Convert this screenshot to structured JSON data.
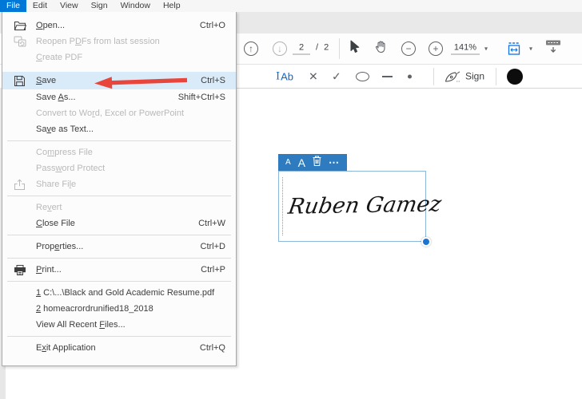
{
  "colors": {
    "accent_blue": "#0078d7",
    "menu_highlight": "#d9eaf8",
    "tool_blue": "#1473e6",
    "signature_toolbar_blue": "#2e7cbf",
    "selection_border_blue": "#8ab7da",
    "resize_handle_blue": "#1b74d2",
    "arrow_red": "#e8463c"
  },
  "menubar": {
    "items": [
      {
        "label": "File",
        "active": true
      },
      {
        "label": "Edit",
        "active": false
      },
      {
        "label": "View",
        "active": false
      },
      {
        "label": "Sign",
        "active": false
      },
      {
        "label": "Window",
        "active": false
      },
      {
        "label": "Help",
        "active": false
      }
    ]
  },
  "file_menu": {
    "items": [
      {
        "type": "item",
        "label": "Open...",
        "mnemonic": 0,
        "shortcut": "Ctrl+O",
        "icon": "folder-open-icon",
        "state": "enabled"
      },
      {
        "type": "item",
        "label": "Reopen PDFs from last session",
        "mnemonic": 8,
        "shortcut": "",
        "icon": "reopen-session-icon",
        "state": "disabled"
      },
      {
        "type": "item",
        "label": "Create PDF",
        "mnemonic": 0,
        "shortcut": "",
        "icon": "",
        "state": "disabled"
      },
      {
        "type": "spacer"
      },
      {
        "type": "item",
        "label": "Save",
        "mnemonic": 0,
        "shortcut": "Ctrl+S",
        "icon": "save-icon",
        "state": "highlighted"
      },
      {
        "type": "item",
        "label": "Save As...",
        "mnemonic": 5,
        "shortcut": "Shift+Ctrl+S",
        "icon": "",
        "state": "enabled"
      },
      {
        "type": "item",
        "label": "Convert to Word, Excel or PowerPoint",
        "mnemonic": 13,
        "shortcut": "",
        "icon": "",
        "state": "disabled"
      },
      {
        "type": "item",
        "label": "Save as Text...",
        "mnemonic": 2,
        "shortcut": "",
        "icon": "",
        "state": "enabled"
      },
      {
        "type": "separator"
      },
      {
        "type": "item",
        "label": "Compress File",
        "mnemonic": 2,
        "shortcut": "",
        "icon": "",
        "state": "disabled"
      },
      {
        "type": "item",
        "label": "Password Protect",
        "mnemonic": 4,
        "shortcut": "",
        "icon": "",
        "state": "disabled"
      },
      {
        "type": "item",
        "label": "Share File",
        "mnemonic": 8,
        "shortcut": "",
        "icon": "share-icon",
        "state": "disabled"
      },
      {
        "type": "separator"
      },
      {
        "type": "item",
        "label": "Revert",
        "mnemonic": 2,
        "shortcut": "",
        "icon": "",
        "state": "disabled"
      },
      {
        "type": "item",
        "label": "Close File",
        "mnemonic": 0,
        "shortcut": "Ctrl+W",
        "icon": "",
        "state": "enabled"
      },
      {
        "type": "separator"
      },
      {
        "type": "item",
        "label": "Properties...",
        "mnemonic": 4,
        "shortcut": "Ctrl+D",
        "icon": "",
        "state": "enabled"
      },
      {
        "type": "separator"
      },
      {
        "type": "item",
        "label": "Print...",
        "mnemonic": 0,
        "shortcut": "Ctrl+P",
        "icon": "print-icon",
        "state": "enabled"
      },
      {
        "type": "separator"
      },
      {
        "type": "item",
        "label": "1 C:\\...\\Black and Gold Academic Resume.pdf",
        "mnemonic": 0,
        "shortcut": "",
        "icon": "",
        "state": "enabled"
      },
      {
        "type": "item",
        "label": "2 homeacrordrunified18_2018",
        "mnemonic": 0,
        "shortcut": "",
        "icon": "",
        "state": "enabled"
      },
      {
        "type": "item",
        "label": "View All Recent Files...",
        "mnemonic": 16,
        "shortcut": "",
        "icon": "",
        "state": "enabled"
      },
      {
        "type": "separator"
      },
      {
        "type": "item",
        "label": "Exit Application",
        "mnemonic": 1,
        "shortcut": "Ctrl+Q",
        "icon": "",
        "state": "enabled"
      }
    ]
  },
  "toolbar": {
    "page_current": "2",
    "page_total": "/ 2",
    "zoom_level": "141%"
  },
  "fill_sign": {
    "text_tool_label": "Ab",
    "sign_label": "Sign"
  },
  "signature": {
    "name": "Ruben Gamez"
  }
}
